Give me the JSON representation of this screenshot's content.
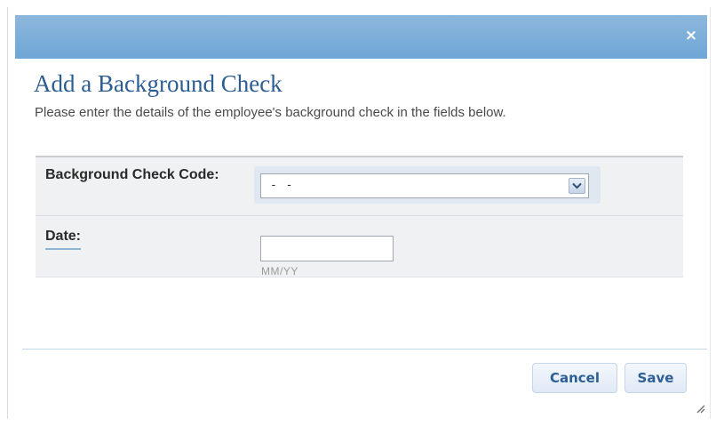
{
  "dialog": {
    "title": "Add a Background Check",
    "description": "Please enter the details of the employee's background check in the fields below.",
    "close_icon": "close-icon",
    "close_glyph": "×"
  },
  "form": {
    "code": {
      "label": "Background Check Code:",
      "selected_value": "- -",
      "dropdown_icon": "chevron-down-icon"
    },
    "date": {
      "label": "Date:",
      "value": "",
      "hint": "MM/YY"
    }
  },
  "buttons": {
    "cancel_label": "Cancel",
    "save_label": "Save"
  },
  "colors": {
    "title_bar": "#7fb0da",
    "heading": "#2b5d93",
    "button_text": "#2d5f94",
    "form_background": "#f0f1f3"
  }
}
